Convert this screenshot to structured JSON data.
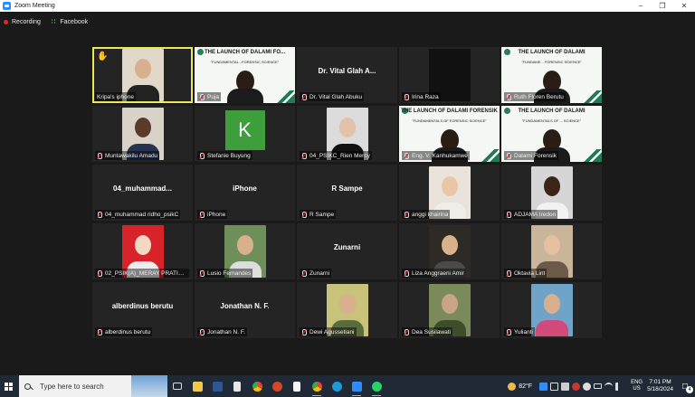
{
  "window": {
    "title": "Zoom Meeting"
  },
  "topbar": {
    "recording_label": "Recording",
    "facebook_label": "Facebook"
  },
  "tiles": [
    {
      "label": "Kripa's iphone",
      "kind": "video",
      "active": true,
      "hand_raised": true,
      "muted": false
    },
    {
      "label": "Puja",
      "kind": "slide",
      "muted": true,
      "slide_title": "THE LAUNCH OF DALAMI FO...",
      "slide_sub": "\"FUNDAMENTAL...FORENSIC SCIENCE\""
    },
    {
      "label": "Dr. Vital Glah Abuku",
      "kind": "name",
      "big_name": "Dr. Vital Glah A...",
      "muted": true
    },
    {
      "label": "Irina Raza",
      "kind": "dark",
      "muted": true
    },
    {
      "label": "Ruth Floren Berutu",
      "kind": "slide",
      "muted": true,
      "slide_title": "THE LAUNCH OF DALAMI",
      "slide_sub": "\"FUNDAME... FORENSIC SCIENCE\""
    },
    {
      "label": "Muntawakilu Amadu",
      "kind": "photo",
      "muted": true
    },
    {
      "label": "Stefanie Buyung",
      "kind": "avatar",
      "avatar_letter": "K",
      "muted": true
    },
    {
      "label": "04_PSIKC_Rien Mercy",
      "kind": "photo",
      "muted": true
    },
    {
      "label": "Eng. V. Kanhukamwe",
      "kind": "slide",
      "muted": true,
      "slide_title": "THE LAUNCH OF DALAMI FORENSIK",
      "slide_sub": "\"FUNDAMENTALS OF FORENSIC SCIENCE\""
    },
    {
      "label": "Dalami Forensik",
      "kind": "slide",
      "muted": true,
      "slide_title": "THE LAUNCH OF DALAMI",
      "slide_sub": "\"FUNDAMENTALS OF ... SCIENCE\""
    },
    {
      "label": "04_muhammad ridho_psikC",
      "kind": "name",
      "big_name": "04_muhammad...",
      "muted": true
    },
    {
      "label": "iPhone",
      "kind": "name",
      "big_name": "iPhone",
      "muted": true
    },
    {
      "label": "R Sampe",
      "kind": "name",
      "big_name": "R Sampe",
      "muted": true
    },
    {
      "label": "anggi khairina",
      "kind": "photo",
      "muted": true
    },
    {
      "label": "ADJAMA Iredon",
      "kind": "photo",
      "muted": true
    },
    {
      "label": "02_PSIK(A)_MERAY PRATIDI...",
      "kind": "photo",
      "muted": true
    },
    {
      "label": "Lusio Fernandes",
      "kind": "photo",
      "muted": true
    },
    {
      "label": "Zunarni",
      "kind": "name",
      "big_name": "Zunarni",
      "muted": true
    },
    {
      "label": "Liza Anggraeni Amir",
      "kind": "photo",
      "muted": true
    },
    {
      "label": "Oktavia Lint",
      "kind": "photo",
      "muted": true
    },
    {
      "label": "alberdinus berutu",
      "kind": "name",
      "big_name": "alberdinus berutu",
      "muted": true
    },
    {
      "label": "Jonathan N. F.",
      "kind": "name",
      "big_name": "Jonathan N. F.",
      "muted": true
    },
    {
      "label": "Dewi Agussetiani",
      "kind": "photo",
      "muted": true
    },
    {
      "label": "Dea Susilawati",
      "kind": "photo",
      "muted": true
    },
    {
      "label": "Yulianti",
      "kind": "photo",
      "muted": true
    }
  ],
  "taskbar": {
    "search_placeholder": "Type here to search",
    "temperature": "82°F",
    "lang_top": "ENG",
    "lang_bottom": "US",
    "time": "7:01 PM",
    "date": "5/18/2024",
    "notifications": "4"
  }
}
